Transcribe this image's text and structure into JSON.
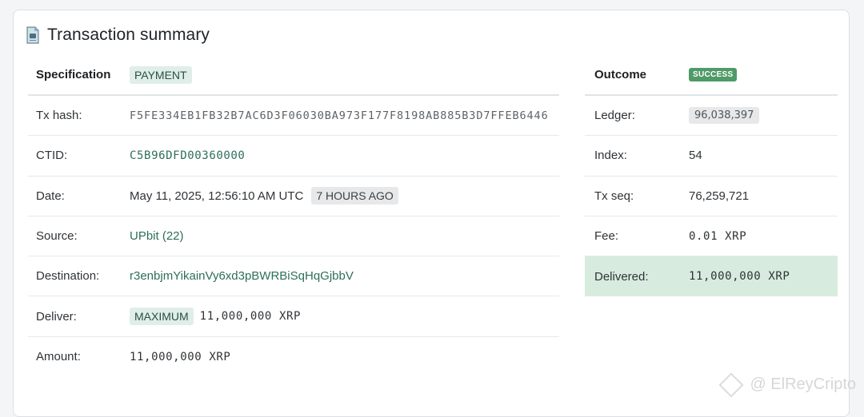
{
  "title": "Transaction summary",
  "left": {
    "specification_label": "Specification",
    "specification_value": "PAYMENT",
    "tx_hash_label": "Tx hash:",
    "tx_hash_value": "F5FE334EB1FB32B7AC6D3F06030BA973F177F8198AB885B3D7FFEB6446",
    "ctid_label": "CTID:",
    "ctid_value": "C5B96DFD00360000",
    "date_label": "Date:",
    "date_value": "May 11, 2025, 12:56:10 AM UTC",
    "date_relative": "7 HOURS AGO",
    "source_label": "Source:",
    "source_value": "UPbit (22)",
    "destination_label": "Destination:",
    "destination_value": "r3enbjmYikainVy6xd3pBWRBiSqHqGjbbV",
    "deliver_label": "Deliver:",
    "deliver_tag": "MAXIMUM",
    "deliver_value": "11,000,000 XRP",
    "amount_label": "Amount:",
    "amount_value": "11,000,000 XRP"
  },
  "right": {
    "outcome_label": "Outcome",
    "outcome_value": "SUCCESS",
    "ledger_label": "Ledger:",
    "ledger_value": "96,038,397",
    "index_label": "Index:",
    "index_value": "54",
    "txseq_label": "Tx seq:",
    "txseq_value": "76,259,721",
    "fee_label": "Fee:",
    "fee_value": "0.01 XRP",
    "delivered_label": "Delivered:",
    "delivered_value": "11,000,000 XRP"
  },
  "watermark": "@ ElReyCripto",
  "icons": {
    "title": "document-icon",
    "watermark": "binance-logo-icon"
  },
  "colors": {
    "success": "#4f9a67",
    "delivered_bg": "#d7ecdf",
    "link": "#2e6e5c"
  }
}
